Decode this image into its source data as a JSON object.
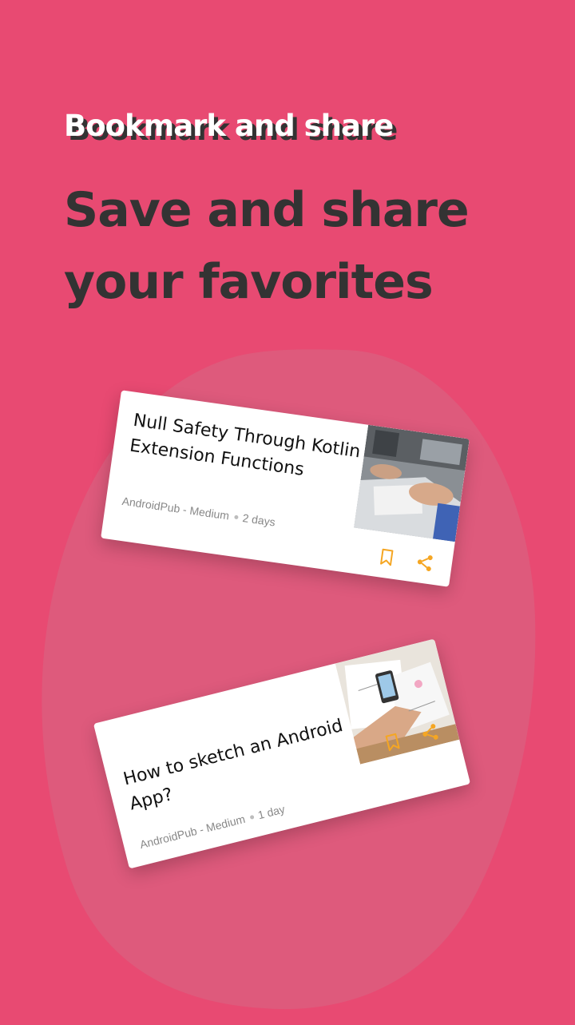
{
  "header": {
    "eyebrow": "Bookmark and share",
    "headline_line1": "Save and share",
    "headline_line2": "your favorites"
  },
  "cards": [
    {
      "title": "Null Safety Through Kotlin Extension Functions",
      "source": "AndroidPub - Medium",
      "age": "2 days",
      "icons": [
        "bookmark-icon",
        "share-icon"
      ]
    },
    {
      "title": "How to sketch an Android App?",
      "source": "AndroidPub - Medium",
      "age": "1 day",
      "icons": [
        "bookmark-icon",
        "share-icon"
      ]
    }
  ],
  "colors": {
    "background": "#e84a72",
    "blob": "#de5a7c",
    "headline": "#333333",
    "accent_icon": "#f5a623",
    "card": "#ffffff"
  }
}
